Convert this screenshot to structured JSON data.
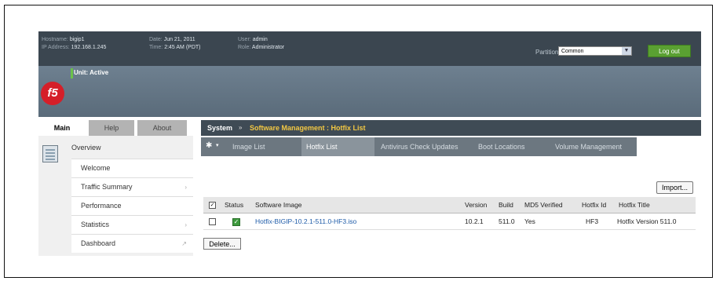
{
  "header": {
    "hostname_label": "Hostname:",
    "hostname": "bigip1",
    "ip_label": "IP Address:",
    "ip": "192.168.1.245",
    "date_label": "Date:",
    "date": "Jun 21, 2011",
    "time_label": "Time:",
    "time": "2:45 AM (PDT)",
    "user_label": "User:",
    "user": "admin",
    "role_label": "Role:",
    "role": "Administrator",
    "partition_label": "Partition:",
    "partition_value": "Common",
    "logout_label": "Log out"
  },
  "banner": {
    "logo_text": "f5",
    "unit_status": "Unit: Active"
  },
  "left_tabs": [
    {
      "label": "Main"
    },
    {
      "label": "Help"
    },
    {
      "label": "About"
    }
  ],
  "left_nav": {
    "section": "Overview",
    "items": [
      {
        "label": "Welcome"
      },
      {
        "label": "Traffic Summary"
      },
      {
        "label": "Performance"
      },
      {
        "label": "Statistics"
      },
      {
        "label": "Dashboard"
      }
    ]
  },
  "breadcrumb": {
    "root": "System",
    "separator": "»",
    "path": "Software Management : Hotfix List"
  },
  "subtabs": [
    {
      "label": "Image List"
    },
    {
      "label": "Hotfix List"
    },
    {
      "label": "Antivirus Check Updates"
    },
    {
      "label": "Boot Locations"
    },
    {
      "label": "Volume Management"
    }
  ],
  "import_label": "Import...",
  "table": {
    "headers": [
      "Status",
      "Software Image",
      "Version",
      "Build",
      "MD5 Verified",
      "Hotfix Id",
      "Hotfix Title"
    ],
    "rows": [
      {
        "image": "Hotfix-BIGIP-10.2.1-511.0-HF3.iso",
        "version": "10.2.1",
        "build": "511.0",
        "md5": "Yes",
        "hotfix_id": "HF3",
        "title": "Hotfix Version 511.0"
      }
    ]
  },
  "delete_label": "Delete...",
  "colors": {
    "topbar": "#3b4650",
    "logo_red": "#d51f29",
    "logout_green": "#5aa032",
    "breadcrumb_path": "#f3c843",
    "link": "#1e5ba8"
  }
}
